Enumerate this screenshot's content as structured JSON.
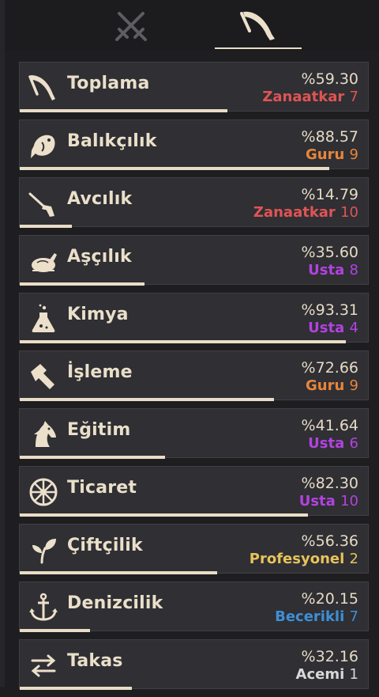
{
  "tabs": [
    {
      "name": "combat",
      "icon": "crossed-swords-icon",
      "active": false
    },
    {
      "name": "gathering",
      "icon": "scythe-icon",
      "active": true
    }
  ],
  "skills": [
    {
      "name": "Toplama",
      "icon": "scythe-icon",
      "percent": "%59.30",
      "progress": 0.593,
      "rank": "Zanaatkar",
      "level": "7",
      "rank_color": "#e05454"
    },
    {
      "name": "Balıkçılık",
      "icon": "fish-icon",
      "percent": "%88.57",
      "progress": 0.8857,
      "rank": "Guru",
      "level": "9",
      "rank_color": "#e8853a"
    },
    {
      "name": "Avcılık",
      "icon": "musket-icon",
      "percent": "%14.79",
      "progress": 0.1479,
      "rank": "Zanaatkar",
      "level": "10",
      "rank_color": "#e05454"
    },
    {
      "name": "Aşçılık",
      "icon": "roast-chicken-icon",
      "percent": "%35.60",
      "progress": 0.356,
      "rank": "Usta",
      "level": "8",
      "rank_color": "#b342e0"
    },
    {
      "name": "Kimya",
      "icon": "flask-icon",
      "percent": "%93.31",
      "progress": 0.9331,
      "rank": "Usta",
      "level": "4",
      "rank_color": "#b342e0"
    },
    {
      "name": "İşleme",
      "icon": "hammer-icon",
      "percent": "%72.66",
      "progress": 0.7266,
      "rank": "Guru",
      "level": "9",
      "rank_color": "#e8853a"
    },
    {
      "name": "Eğitim",
      "icon": "horse-head-icon",
      "percent": "%41.64",
      "progress": 0.4164,
      "rank": "Usta",
      "level": "6",
      "rank_color": "#b342e0"
    },
    {
      "name": "Ticaret",
      "icon": "wheel-icon",
      "percent": "%82.30",
      "progress": 0.823,
      "rank": "Usta",
      "level": "10",
      "rank_color": "#b342e0"
    },
    {
      "name": "Çiftçilik",
      "icon": "sprout-icon",
      "percent": "%56.36",
      "progress": 0.5636,
      "rank": "Profesyonel",
      "level": "2",
      "rank_color": "#e8c35a"
    },
    {
      "name": "Denizcilik",
      "icon": "anchor-icon",
      "percent": "%20.15",
      "progress": 0.2015,
      "rank": "Becerikli",
      "level": "7",
      "rank_color": "#3e8fd6"
    },
    {
      "name": "Takas",
      "icon": "swap-arrows-icon",
      "percent": "%32.16",
      "progress": 0.3216,
      "rank": "Acemi",
      "level": "1",
      "rank_color": "#d8d8d8"
    }
  ]
}
